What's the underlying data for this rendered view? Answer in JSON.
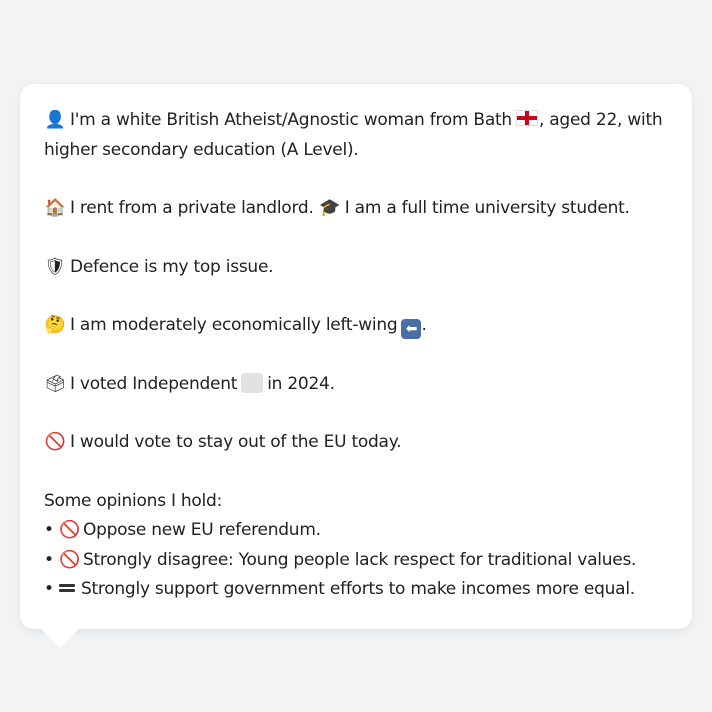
{
  "profile": {
    "intro": {
      "icon": "person-silhouette-icon",
      "text_before_flag": "I'm a white British Atheist/Agnostic woman from Bath",
      "flag_icon": "england-flag-icon",
      "text_after_flag": ", aged 22, with",
      "continuation": "higher secondary education (A Level)."
    },
    "housing": {
      "icon": "house-icon",
      "text": "I rent from a private landlord.",
      "occupation_icon": "graduation-cap-icon",
      "occupation_text": "I am a full time university student."
    },
    "top_issue": {
      "icon": "shield-icon",
      "text": "Defence is my top issue."
    },
    "economics": {
      "icon": "thinking-face-icon",
      "text": "I am moderately economically left-wing",
      "arrow_icon": "left-arrow-icon",
      "trailing": "."
    },
    "vote": {
      "icon": "ballot-box-icon",
      "text_before": "I voted Independent",
      "party_color": "#e2e2e2",
      "text_after": "in 2024."
    },
    "eu": {
      "icon": "prohibited-icon",
      "text": "I would vote to stay out of the EU today."
    },
    "opinions": {
      "heading": "Some opinions I hold:",
      "bullet": "•",
      "items": [
        {
          "icon": "prohibited-icon",
          "text": "Oppose new EU referendum."
        },
        {
          "icon": "prohibited-icon",
          "text": "Strongly disagree: Young people lack respect for traditional values."
        },
        {
          "icon": "equals-icon",
          "text": "Strongly support government efforts to make incomes more equal."
        }
      ]
    }
  },
  "colors": {
    "background": "#f2f3f5",
    "card": "#ffffff",
    "text": "#202124",
    "flag_red": "#d0021b",
    "arrow_box": "#4a6fa5"
  }
}
